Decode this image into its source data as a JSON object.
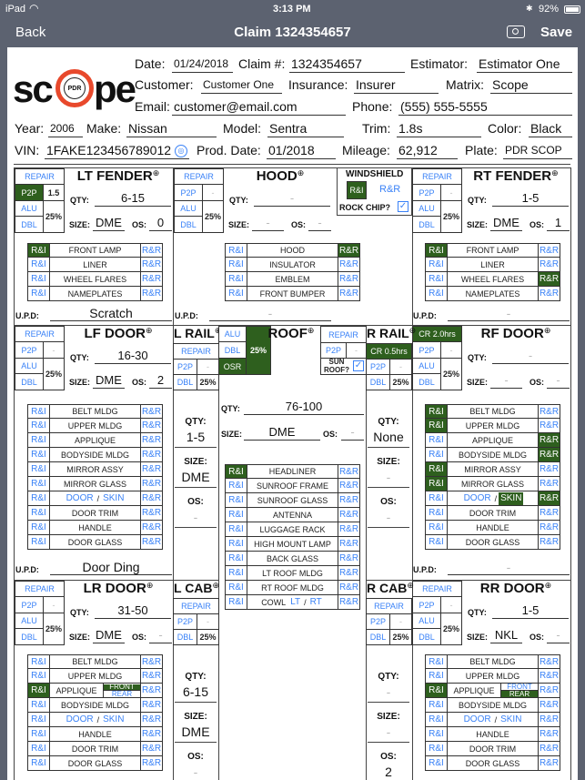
{
  "status": {
    "device": "iPad",
    "time": "3:13 PM",
    "battery": "92%"
  },
  "nav": {
    "back": "Back",
    "title": "Claim 1324354657",
    "save": "Save"
  },
  "logo": {
    "text": "scope",
    "badge": "PDR",
    "color": "#e8492c"
  },
  "colors": {
    "active": "#2e5f1e",
    "link": "#3a82f7"
  },
  "header": {
    "date": {
      "label": "Date:",
      "value": "01/24/2018"
    },
    "claim": {
      "label": "Claim #:",
      "value": "1324354657"
    },
    "estimator": {
      "label": "Estimator:",
      "value": "Estimator One"
    },
    "customer": {
      "label": "Customer:",
      "value": "Customer One"
    },
    "insurance": {
      "label": "Insurance:",
      "value": "Insurer"
    },
    "matrix": {
      "label": "Matrix:",
      "value": "Scope"
    },
    "email": {
      "label": "Email:",
      "value": "customer@email.com"
    },
    "phone": {
      "label": "Phone:",
      "value": "(555) 555-5555"
    },
    "year": {
      "label": "Year:",
      "value": "2006"
    },
    "make": {
      "label": "Make:",
      "value": "Nissan"
    },
    "model": {
      "label": "Model:",
      "value": "Sentra"
    },
    "trim": {
      "label": "Trim:",
      "value": "1.8s"
    },
    "color": {
      "label": "Color:",
      "value": "Black"
    },
    "vin": {
      "label": "VIN:",
      "value": "1FAKE123456789012"
    },
    "prod_date": {
      "label": "Prod. Date:",
      "value": "01/2018"
    },
    "mileage": {
      "label": "Mileage:",
      "value": "62,912"
    },
    "plate": {
      "label": "Plate:",
      "value": "PDR SCOP"
    }
  },
  "common": {
    "repair": "REPAIR",
    "p2p": "P2P",
    "alu": "ALU",
    "dbl": "DBL",
    "osr": "OSR",
    "qty": "QTY:",
    "size": "SIZE:",
    "os": "OS:",
    "upd": "U.P.D:",
    "ri": "R&I",
    "rr": "R&R",
    "dash": "-"
  },
  "windshield": {
    "title": "WINDSHIELD",
    "ri_active": true,
    "rr_active": false,
    "rock_chip_label": "ROCK CHIP?",
    "rock_chip": true
  },
  "panels": {
    "lt_fender": {
      "title": "LT FENDER",
      "repair_label": "REPAIR",
      "repair_active": false,
      "p2p_active": true,
      "p2p_value": "1.5",
      "pct": "25%",
      "qty": "6-15",
      "size": "DME",
      "os": "0",
      "upd": "Scratch",
      "items": [
        {
          "name": "FRONT LAMP",
          "ri": true,
          "rr": false
        },
        {
          "name": "LINER",
          "ri": false,
          "rr": false
        },
        {
          "name": "WHEEL FLARES",
          "ri": false,
          "rr": false
        },
        {
          "name": "NAMEPLATES",
          "ri": false,
          "rr": false
        }
      ]
    },
    "hood": {
      "title": "HOOD",
      "repair_label": "REPAIR",
      "repair_active": false,
      "p2p_active": false,
      "p2p_value": "-",
      "pct": "25%",
      "qty": "-",
      "size": "-",
      "os": "-",
      "upd": "-",
      "items": [
        {
          "name": "HOOD",
          "ri": false,
          "rr": true
        },
        {
          "name": "INSULATOR",
          "ri": false,
          "rr": false
        },
        {
          "name": "EMBLEM",
          "ri": false,
          "rr": false
        },
        {
          "name": "FRONT BUMPER",
          "ri": false,
          "rr": false
        }
      ]
    },
    "rt_fender": {
      "title": "RT FENDER",
      "repair_label": "REPAIR",
      "repair_active": false,
      "p2p_active": false,
      "p2p_value": "-",
      "pct": "25%",
      "qty": "1-5",
      "size": "DME",
      "os": "1",
      "upd": "-",
      "items": [
        {
          "name": "FRONT LAMP",
          "ri": true,
          "rr": false
        },
        {
          "name": "LINER",
          "ri": false,
          "rr": false
        },
        {
          "name": "WHEEL FLARES",
          "ri": false,
          "rr": true
        },
        {
          "name": "NAMEPLATES",
          "ri": false,
          "rr": false
        }
      ]
    },
    "lf_door": {
      "title": "LF DOOR",
      "repair_label": "REPAIR",
      "repair_active": false,
      "p2p_active": false,
      "p2p_value": "-",
      "pct": "25%",
      "qty": "16-30",
      "size": "DME",
      "os": "2",
      "upd": "Door Ding",
      "items": [
        {
          "name": "BELT MLDG",
          "ri": false,
          "rr": false
        },
        {
          "name": "UPPER MLDG",
          "ri": false,
          "rr": false
        },
        {
          "name": "APPLIQUE",
          "ri": false,
          "rr": false
        },
        {
          "name": "BODYSIDE MLDG",
          "ri": false,
          "rr": false
        },
        {
          "name": "MIRROR ASSY",
          "ri": false,
          "rr": false
        },
        {
          "name": "MIRROR GLASS",
          "ri": false,
          "rr": false
        },
        {
          "name": "",
          "parts": [
            {
              "label": "DOOR",
              "active": false
            },
            {
              "label": "SKIN",
              "active": false
            }
          ],
          "ri": false,
          "rr": false
        },
        {
          "name": "DOOR TRIM",
          "ri": false,
          "rr": false
        },
        {
          "name": "HANDLE",
          "ri": false,
          "rr": false
        },
        {
          "name": "DOOR GLASS",
          "ri": false,
          "rr": false
        }
      ]
    },
    "rf_door": {
      "title": "RF DOOR",
      "repair_label": "CR 2.0hrs",
      "repair_active": true,
      "p2p_active": false,
      "p2p_value": "-",
      "pct": "25%",
      "qty": "-",
      "size": "-",
      "os": "-",
      "upd": "-",
      "items": [
        {
          "name": "BELT MLDG",
          "ri": true,
          "rr": false
        },
        {
          "name": "UPPER MLDG",
          "ri": true,
          "rr": false
        },
        {
          "name": "APPLIQUE",
          "ri": false,
          "rr": true
        },
        {
          "name": "BODYSIDE MLDG",
          "ri": false,
          "rr": true
        },
        {
          "name": "MIRROR ASSY",
          "ri": true,
          "rr": false
        },
        {
          "name": "MIRROR GLASS",
          "ri": true,
          "rr": false
        },
        {
          "name": "",
          "parts": [
            {
              "label": "DOOR",
              "active": false
            },
            {
              "label": "SKIN",
              "active": true
            }
          ],
          "ri": false,
          "rr": true
        },
        {
          "name": "DOOR TRIM",
          "ri": false,
          "rr": false
        },
        {
          "name": "HANDLE",
          "ri": false,
          "rr": false
        },
        {
          "name": "DOOR GLASS",
          "ri": false,
          "rr": false
        }
      ]
    },
    "lr_door": {
      "title": "LR DOOR",
      "repair_label": "REPAIR",
      "repair_active": false,
      "p2p_active": false,
      "p2p_value": "-",
      "pct": "25%",
      "qty": "31-50",
      "size": "DME",
      "os": "-",
      "items": [
        {
          "name": "BELT MLDG",
          "ri": false,
          "rr": false
        },
        {
          "name": "UPPER MLDG",
          "ri": false,
          "rr": false
        },
        {
          "name": "APPLIQUE",
          "sub": [
            {
              "label": "FRONT",
              "active": true
            },
            {
              "label": "REAR",
              "active": false
            }
          ],
          "ri": true,
          "rr": false
        },
        {
          "name": "BODYSIDE MLDG",
          "ri": false,
          "rr": false
        },
        {
          "name": "",
          "parts": [
            {
              "label": "DOOR",
              "active": false
            },
            {
              "label": "SKIN",
              "active": false
            }
          ],
          "ri": false,
          "rr": false
        },
        {
          "name": "HANDLE",
          "ri": false,
          "rr": false
        },
        {
          "name": "DOOR TRIM",
          "ri": false,
          "rr": false
        },
        {
          "name": "DOOR GLASS",
          "ri": false,
          "rr": false
        }
      ]
    },
    "rr_door": {
      "title": "RR DOOR",
      "repair_label": "REPAIR",
      "repair_active": false,
      "p2p_active": false,
      "p2p_value": "-",
      "pct": "25%",
      "qty": "1-5",
      "size": "NKL",
      "os": "-",
      "items": [
        {
          "name": "BELT MLDG",
          "ri": false,
          "rr": false
        },
        {
          "name": "UPPER MLDG",
          "ri": false,
          "rr": false
        },
        {
          "name": "APPLIQUE",
          "sub": [
            {
              "label": "FRONT",
              "active": false
            },
            {
              "label": "REAR",
              "active": true
            }
          ],
          "ri": true,
          "rr": false
        },
        {
          "name": "BODYSIDE MLDG",
          "ri": false,
          "rr": false
        },
        {
          "name": "",
          "parts": [
            {
              "label": "DOOR",
              "active": false
            },
            {
              "label": "SKIN",
              "active": false
            }
          ],
          "ri": false,
          "rr": false
        },
        {
          "name": "HANDLE",
          "ri": false,
          "rr": false
        },
        {
          "name": "DOOR TRIM",
          "ri": false,
          "rr": false
        },
        {
          "name": "DOOR GLASS",
          "ri": false,
          "rr": false
        }
      ]
    }
  },
  "rails": {
    "l_rail": {
      "title": "L RAIL",
      "repair_label": "REPAIR",
      "repair_active": false,
      "p2p_value": "-",
      "pct": "25%",
      "qty": "1-5",
      "size": "DME",
      "os": "-"
    },
    "r_rail": {
      "title": "R RAIL",
      "repair_label": "CR 0.5hrs",
      "repair_active": true,
      "p2p_value": "-",
      "pct": "25%",
      "qty": "None",
      "size": "-",
      "os": "-"
    },
    "l_cab": {
      "title": "L CAB",
      "repair_label": "REPAIR",
      "repair_active": false,
      "p2p_value": "-",
      "pct": "25%",
      "qty": "6-15",
      "size": "DME",
      "os": "-"
    },
    "r_cab": {
      "title": "R CAB",
      "repair_label": "REPAIR",
      "repair_active": false,
      "p2p_value": "-",
      "pct": "25%",
      "qty": "-",
      "size": "-",
      "os": "2"
    }
  },
  "roof": {
    "title": "ROOF",
    "repair_label": "REPAIR",
    "alu_active": false,
    "dbl_active": false,
    "osr_active": true,
    "pct": "25%",
    "pct_active": true,
    "p2p_value": "-",
    "sunroof_label": "SUN ROOF?",
    "sunroof": true,
    "qty": "76-100",
    "size": "DME",
    "os": "-",
    "items": [
      {
        "name": "HEADLINER",
        "ri": true,
        "rr": false
      },
      {
        "name": "SUNROOF FRAME",
        "ri": false,
        "rr": false
      },
      {
        "name": "SUNROOF GLASS",
        "ri": false,
        "rr": false
      },
      {
        "name": "ANTENNA",
        "ri": false,
        "rr": false
      },
      {
        "name": "LUGGAGE RACK",
        "ri": false,
        "rr": false
      },
      {
        "name": "HIGH MOUNT LAMP",
        "ri": false,
        "rr": false
      },
      {
        "name": "BACK GLASS",
        "ri": false,
        "rr": false
      },
      {
        "name": "LT ROOF MLDG",
        "ri": false,
        "rr": false
      },
      {
        "name": "RT ROOF MLDG",
        "ri": false,
        "rr": false
      },
      {
        "name": "COWL",
        "parts": [
          {
            "label": "LT",
            "active": false
          },
          {
            "label": "RT",
            "active": false
          }
        ],
        "ri": false,
        "rr": false
      }
    ]
  }
}
